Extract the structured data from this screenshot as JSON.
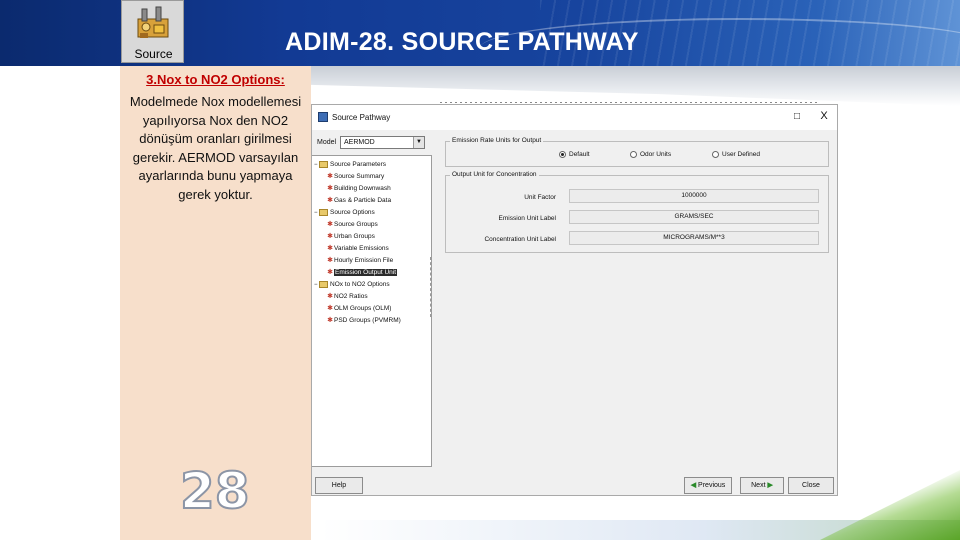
{
  "header": {
    "title": "ADIM-28. SOURCE PATHWAY",
    "tile_label": "Source",
    "tile_icon": "source-factory-icon"
  },
  "note": {
    "heading": "3.Nox to NO2 Options:",
    "body": "Modelmede Nox modellemesi yapılıyorsa Nox den NO2 dönüşüm oranları girilmesi gerekir. AERMOD varsayılan ayarlarında bunu yapmaya gerek yoktur.",
    "slide_number": "28"
  },
  "dialog": {
    "title": "Source Pathway",
    "maximize_label": "□",
    "close_label": "X",
    "model_label": "Model",
    "model_value": "AERMOD",
    "tree": [
      {
        "label": "Source Parameters",
        "level": 0,
        "kind": "folder"
      },
      {
        "label": "Source Summary",
        "level": 1,
        "kind": "item"
      },
      {
        "label": "Building Downwash",
        "level": 1,
        "kind": "item"
      },
      {
        "label": "Gas & Particle Data",
        "level": 1,
        "kind": "item"
      },
      {
        "label": "Source Options",
        "level": 0,
        "kind": "folder"
      },
      {
        "label": "Source Groups",
        "level": 1,
        "kind": "item"
      },
      {
        "label": "Urban Groups",
        "level": 1,
        "kind": "item"
      },
      {
        "label": "Variable Emissions",
        "level": 1,
        "kind": "item"
      },
      {
        "label": "Hourly Emission File",
        "level": 1,
        "kind": "item"
      },
      {
        "label": "Emission Output Unit",
        "level": 1,
        "kind": "item",
        "selected": true
      },
      {
        "label": "NOx to NO2 Options",
        "level": 0,
        "kind": "folder"
      },
      {
        "label": "NO2 Ratios",
        "level": 1,
        "kind": "item"
      },
      {
        "label": "OLM Groups (OLM)",
        "level": 1,
        "kind": "item"
      },
      {
        "label": "PSD Groups (PVMRM)",
        "level": 1,
        "kind": "item"
      }
    ],
    "emission_group": {
      "title": "Emission Rate Units for Output",
      "options": [
        {
          "label": "Default",
          "checked": true
        },
        {
          "label": "Odor Units",
          "checked": false
        },
        {
          "label": "User Defined",
          "checked": false
        }
      ]
    },
    "concentration_group": {
      "title": "Output Unit for Concentration",
      "fields": [
        {
          "label": "Unit Factor",
          "value": "1000000"
        },
        {
          "label": "Emission Unit Label",
          "value": "GRAMS/SEC"
        },
        {
          "label": "Concentration Unit Label",
          "value": "MICROGRAMS/M**3"
        }
      ]
    },
    "buttons": {
      "help": "Help",
      "previous": "Previous",
      "next": "Next",
      "close": "Close"
    }
  },
  "colors": {
    "header_blue": "#123a94",
    "note_bg": "#f7dfcb",
    "note_heading": "#c00000"
  }
}
